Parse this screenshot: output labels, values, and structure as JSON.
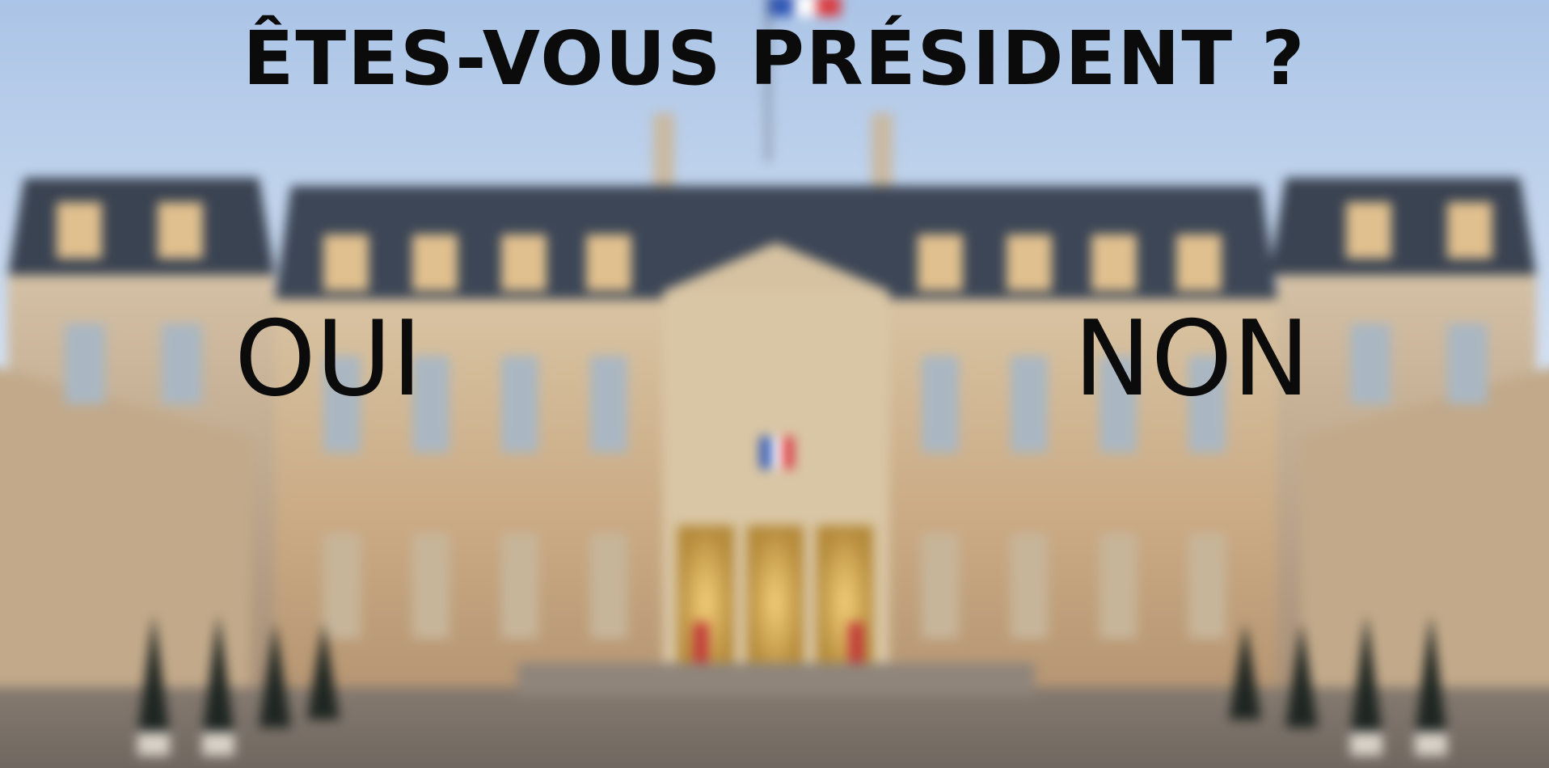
{
  "question": "ÊTES-VOUS PRÉSIDENT ?",
  "answers": {
    "yes": "OUI",
    "no": "NON"
  },
  "colors": {
    "text": "#0b0b0b",
    "sky": "#dfe8f4",
    "stone": "#cdb48e",
    "roof": "#3c4656",
    "door": "#c9a04d"
  },
  "background": {
    "subject": "blurred-palace-courtyard"
  }
}
